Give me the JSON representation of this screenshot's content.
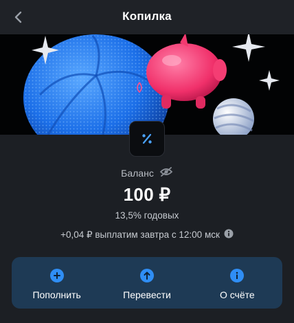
{
  "header": {
    "title": "Копилка",
    "back_icon": "chevron-left-icon"
  },
  "banner": {
    "decor": [
      "blue-ball",
      "pink-piggy-bank",
      "striped-sphere",
      "sparkle-stars"
    ]
  },
  "badge": {
    "icon": "percent-icon",
    "glyph": "%"
  },
  "balance": {
    "label": "Баланс",
    "visibility_icon": "eye-off-icon",
    "amount": "100 ₽",
    "rate": "13,5% годовых",
    "accrual_text": "+0,04 ₽ выплатим завтра с 12:00 мск",
    "info_icon": "info-icon"
  },
  "actions": [
    {
      "label": "Пополнить",
      "icon": "plus-circle-icon"
    },
    {
      "label": "Перевести",
      "icon": "arrow-up-circle-icon"
    },
    {
      "label": "О счёте",
      "icon": "info-circle-icon"
    }
  ],
  "colors": {
    "background": "#1c1f24",
    "action_panel": "#1e3a55",
    "accent": "#2f8ef5"
  }
}
